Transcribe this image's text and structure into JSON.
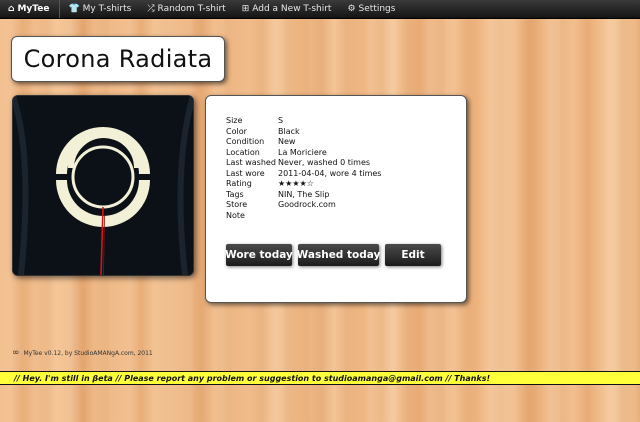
{
  "nav": {
    "brand": "MyTee",
    "brand_icon": "home-icon",
    "items": [
      {
        "label": "My T-shirts",
        "icon": "tshirt-icon"
      },
      {
        "label": "Random T-shirt",
        "icon": "shuffle-icon"
      },
      {
        "label": "Add a New T-shirt",
        "icon": "plus-square-icon"
      },
      {
        "label": "Settings",
        "icon": "gear-icon"
      }
    ]
  },
  "tshirt": {
    "name": "Corona Radiata",
    "properties": [
      {
        "key": "Size",
        "value": "S"
      },
      {
        "key": "Color",
        "value": "Black"
      },
      {
        "key": "Condition",
        "value": "New"
      },
      {
        "key": "Location",
        "value": "La Moriciere"
      },
      {
        "key": "Last washed",
        "value": "Never, washed 0 times"
      },
      {
        "key": "Last wore",
        "value": "2011-04-04, wore 4 times"
      },
      {
        "key": "Rating",
        "value": "★★★★☆"
      },
      {
        "key": "Tags",
        "value": "NIN, The Slip"
      },
      {
        "key": "Store",
        "value": "Goodrock.com"
      },
      {
        "key": "Note",
        "value": ""
      }
    ],
    "rating": 4,
    "rating_max": 5
  },
  "actions": {
    "wore": "Wore today",
    "washed": "Washed today",
    "edit": "Edit"
  },
  "footer": {
    "credit": "MyTee v0.12, by StudioAMANgA.com, 2011",
    "credit_icon": "infinity-icon"
  },
  "banner": {
    "text": "// Hey. I'm still in βeta // Please report any problem or suggestion to studioamanga@gmail.com // Thanks!"
  },
  "colors": {
    "navbar": "#1e1e1e",
    "banner": "#ffff3a",
    "button": "#2a2a2a",
    "shirt": "#0c1117",
    "print": "#f2f0d6",
    "accent_red": "#d01818"
  }
}
